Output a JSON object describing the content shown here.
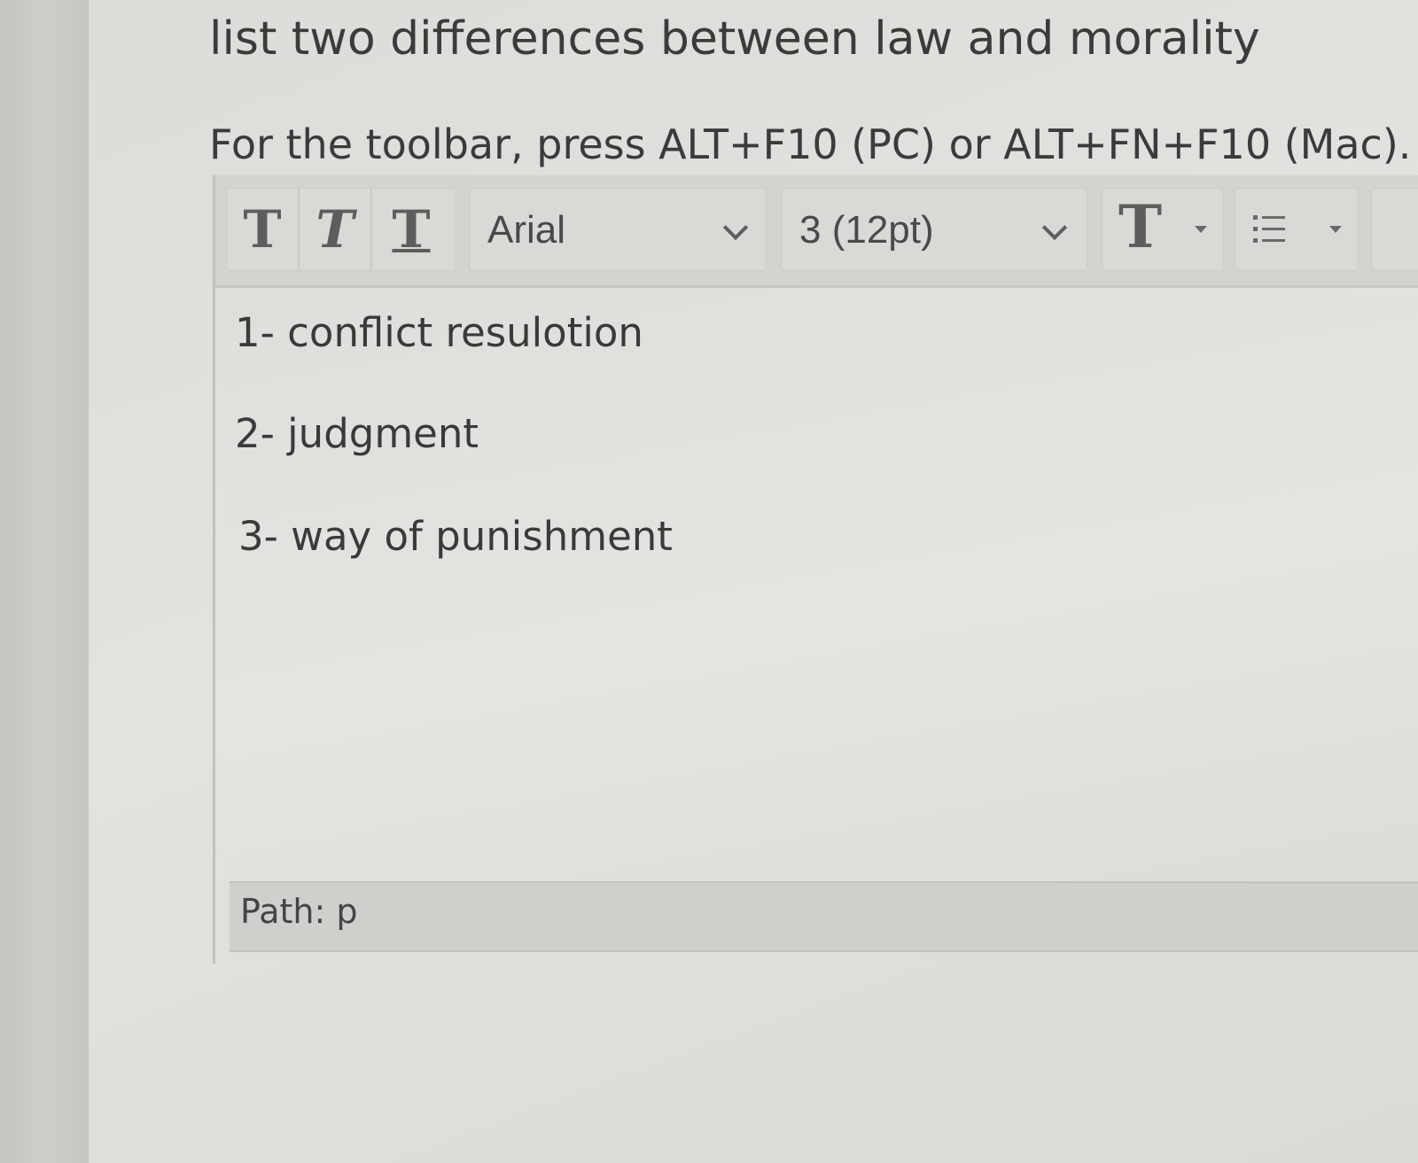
{
  "question": {
    "text": "list two differences between law and morality"
  },
  "toolbar_hint": "For the toolbar, press ALT+F10 (PC) or ALT+FN+F10 (Mac).",
  "toolbar": {
    "bold_glyph": "T",
    "italic_glyph": "T",
    "underline_glyph": "T",
    "font_family_value": "Arial",
    "font_size_value": "3 (12pt)",
    "text_color_glyph": "T",
    "icons": {
      "bold": "bold-icon",
      "italic": "italic-icon",
      "underline": "underline-icon",
      "font_family_dropdown": "chevron-down-icon",
      "font_size_dropdown": "chevron-down-icon",
      "text_color": "text-color-icon",
      "list": "bullet-list-icon"
    }
  },
  "editor": {
    "lines": [
      "1- conflict resulotion",
      "2- judgment",
      "3- way of punishment"
    ]
  },
  "statusbar": {
    "path": "Path: p"
  }
}
